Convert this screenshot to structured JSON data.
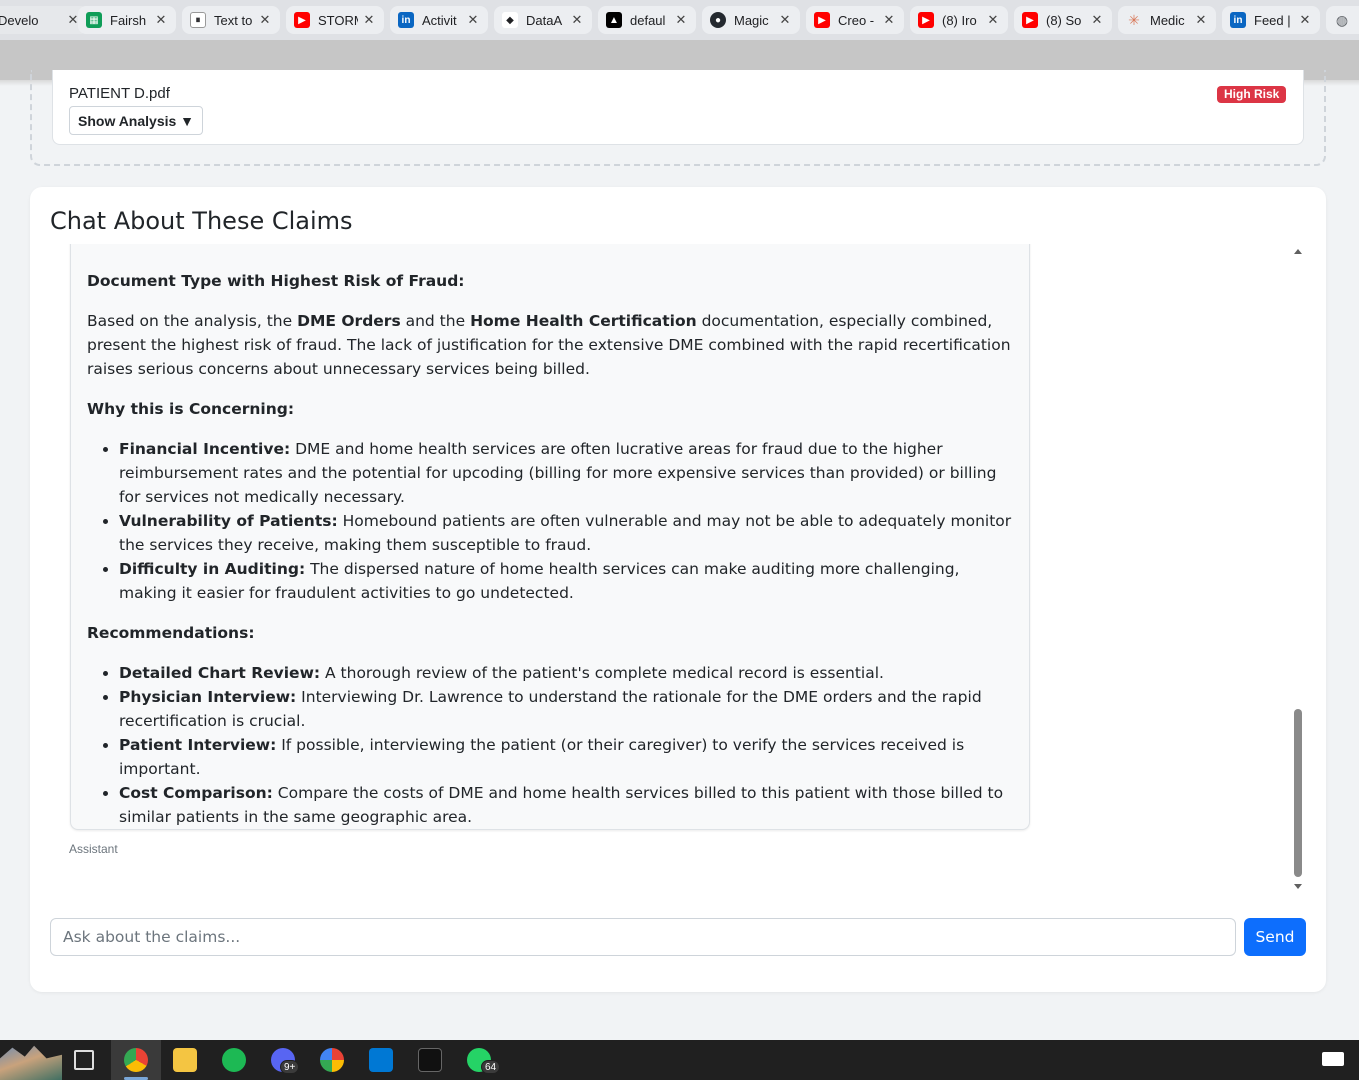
{
  "browser": {
    "tabs": [
      {
        "title": "Develo",
        "icon": "generic-icon",
        "color": "#5f6368"
      },
      {
        "title": "Fairsh",
        "icon": "sheets-icon",
        "color": "#0f9d58"
      },
      {
        "title": "Text to",
        "icon": "pause-icon",
        "color": "#202124"
      },
      {
        "title": "STORM",
        "icon": "youtube-icon",
        "color": "#ff0000"
      },
      {
        "title": "Activit",
        "icon": "linkedin-icon",
        "color": "#0a66c2"
      },
      {
        "title": "DataA",
        "icon": "data-icon",
        "color": "#202124"
      },
      {
        "title": "defaul",
        "icon": "vercel-icon",
        "color": "#000000"
      },
      {
        "title": "Magic",
        "icon": "github-icon",
        "color": "#24292f"
      },
      {
        "title": "Creo -",
        "icon": "youtube-icon",
        "color": "#ff0000"
      },
      {
        "title": "(8) Iro",
        "icon": "youtube-icon",
        "color": "#ff0000"
      },
      {
        "title": "(8) So",
        "icon": "youtube-icon",
        "color": "#ff0000"
      },
      {
        "title": "Medic",
        "icon": "claude-icon",
        "color": "#d97757"
      },
      {
        "title": "Feed |",
        "icon": "linkedin-icon",
        "color": "#0a66c2"
      }
    ]
  },
  "file_card": {
    "file_name": "PATIENT D.pdf",
    "risk_badge": "High Risk",
    "show_analysis": "Show Analysis ▼"
  },
  "chat": {
    "title": "Chat About These Claims",
    "message": {
      "heading_1": "Document Type with Highest Risk of Fraud:",
      "para_1_prefix": "Based on the analysis, the ",
      "para_1_b1": "DME Orders",
      "para_1_mid": " and the ",
      "para_1_b2": "Home Health Certification",
      "para_1_suffix": " documentation, especially combined, present the highest risk of fraud. The lack of justification for the extensive DME combined with the rapid recertification raises serious concerns about unnecessary services being billed.",
      "heading_2": "Why this is Concerning:",
      "concerns": [
        {
          "label": "Financial Incentive:",
          "text": " DME and home health services are often lucrative areas for fraud due to the higher reimbursement rates and the potential for upcoding (billing for more expensive services than provided) or billing for services not medically necessary."
        },
        {
          "label": "Vulnerability of Patients:",
          "text": " Homebound patients are often vulnerable and may not be able to adequately monitor the services they receive, making them susceptible to fraud."
        },
        {
          "label": "Difficulty in Auditing:",
          "text": " The dispersed nature of home health services can make auditing more challenging, making it easier for fraudulent activities to go undetected."
        }
      ],
      "heading_3": "Recommendations:",
      "recommendations": [
        {
          "label": "Detailed Chart Review:",
          "text": " A thorough review of the patient's complete medical record is essential."
        },
        {
          "label": "Physician Interview:",
          "text": " Interviewing Dr. Lawrence to understand the rationale for the DME orders and the rapid recertification is crucial."
        },
        {
          "label": "Patient Interview:",
          "text": " If possible, interviewing the patient (or their caregiver) to verify the services received is important."
        },
        {
          "label": "Cost Comparison:",
          "text": " Compare the costs of DME and home health services billed to this patient with those billed to similar patients in the same geographic area."
        }
      ],
      "role": "Assistant"
    },
    "input_placeholder": "Ask about the claims...",
    "send_label": "Send"
  },
  "taskbar": {
    "discord_badge": "9+",
    "whatsapp_badge": "64"
  },
  "colors": {
    "danger": "#dc3545",
    "primary": "#0d6efd"
  }
}
